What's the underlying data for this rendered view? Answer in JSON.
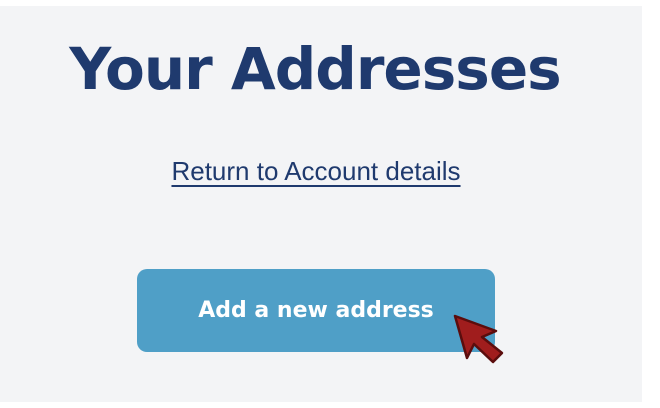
{
  "page": {
    "title": "Your Addresses",
    "return_link_label": "Return to Account details",
    "add_button_label": "Add a new address"
  },
  "colors": {
    "background": "#f3f4f6",
    "title_text": "#1f3a6e",
    "button_background": "#4f9fc7",
    "button_text": "#ffffff",
    "cursor_fill": "#a01d1d"
  },
  "icons": {
    "cursor": "mouse-pointer-icon"
  }
}
